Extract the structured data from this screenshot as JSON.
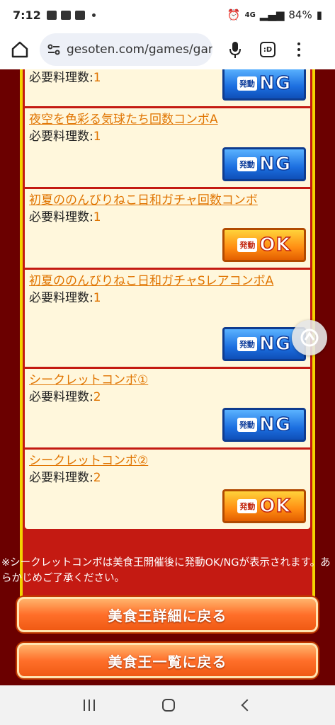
{
  "status_bar": {
    "time": "7:12",
    "network": "4G",
    "battery": "84%"
  },
  "browser": {
    "url": "gesoten.com/games/gar",
    "tabs_label": ":D"
  },
  "combos": [
    {
      "title": "",
      "req_label": "必要料理数:",
      "req_value": "1",
      "badge_small": "発動",
      "badge_big": "NG",
      "status": "ng"
    },
    {
      "title": "夜空を色彩る気球たち回数コンボA",
      "req_label": "必要料理数:",
      "req_value": "1",
      "badge_small": "発動",
      "badge_big": "NG",
      "status": "ng"
    },
    {
      "title": "初夏ののんびりねこ日和ガチャ回数コンボ",
      "req_label": "必要料理数:",
      "req_value": "1",
      "badge_small": "発動",
      "badge_big": "OK",
      "status": "ok"
    },
    {
      "title": "初夏ののんびりねこ日和ガチャSレアコンボA",
      "req_label": "必要料理数:",
      "req_value": "1",
      "badge_small": "発動",
      "badge_big": "NG",
      "status": "ng"
    },
    {
      "title": "シークレットコンボ①",
      "req_label": "必要料理数:",
      "req_value": "2",
      "badge_small": "発動",
      "badge_big": "NG",
      "status": "ng"
    },
    {
      "title": "シークレットコンボ②",
      "req_label": "必要料理数:",
      "req_value": "2",
      "badge_small": "発動",
      "badge_big": "OK",
      "status": "ok"
    }
  ],
  "note": "※シークレットコンボは美食王開催後に発動OK/NGが表示されます。あらかじめご了承ください。",
  "buttons": {
    "detail": "美食王詳細に戻る",
    "list": "美食王一覧に戻る"
  },
  "colors": {
    "background": "#6b0000",
    "panel_border": "#c41a12",
    "link": "#e07400",
    "ng": "#1c6fe0",
    "ok": "#ff8c12"
  }
}
